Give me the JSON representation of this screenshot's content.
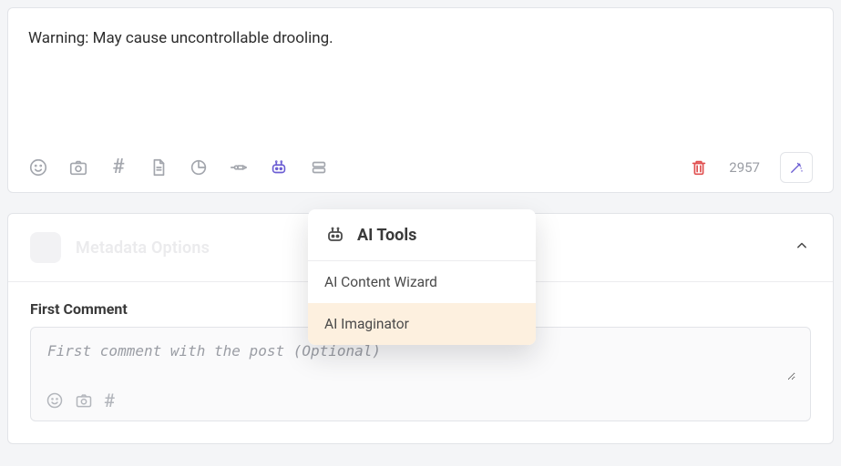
{
  "compose": {
    "text": "Warning: May cause uncontrollable drooling.",
    "char_count": "2957"
  },
  "options": {
    "header_label": "Metadata Options",
    "first_comment_label": "First Comment",
    "first_comment_placeholder": "First comment with the post (Optional)"
  },
  "ai_popover": {
    "title": "AI Tools",
    "items": [
      {
        "label": "AI Content Wizard"
      },
      {
        "label": "AI Imaginator"
      }
    ]
  }
}
